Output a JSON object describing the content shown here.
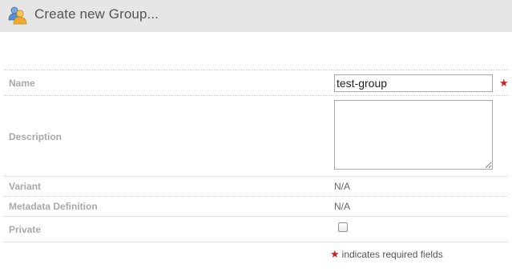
{
  "header": {
    "title": "Create new Group...",
    "icon": "group-users-icon"
  },
  "form": {
    "name": {
      "label": "Name",
      "value": "test-group",
      "required": true
    },
    "description": {
      "label": "Description",
      "value": ""
    },
    "variant": {
      "label": "Variant",
      "value": "N/A"
    },
    "metadata_definition": {
      "label": "Metadata Definition",
      "value": "N/A"
    },
    "private": {
      "label": "Private",
      "checked": false
    },
    "required_marker": "★",
    "required_note": "indicates required fields"
  },
  "colors": {
    "header_bg": "#e6e6e6",
    "required": "#d02020",
    "label": "#a9a9a9"
  }
}
